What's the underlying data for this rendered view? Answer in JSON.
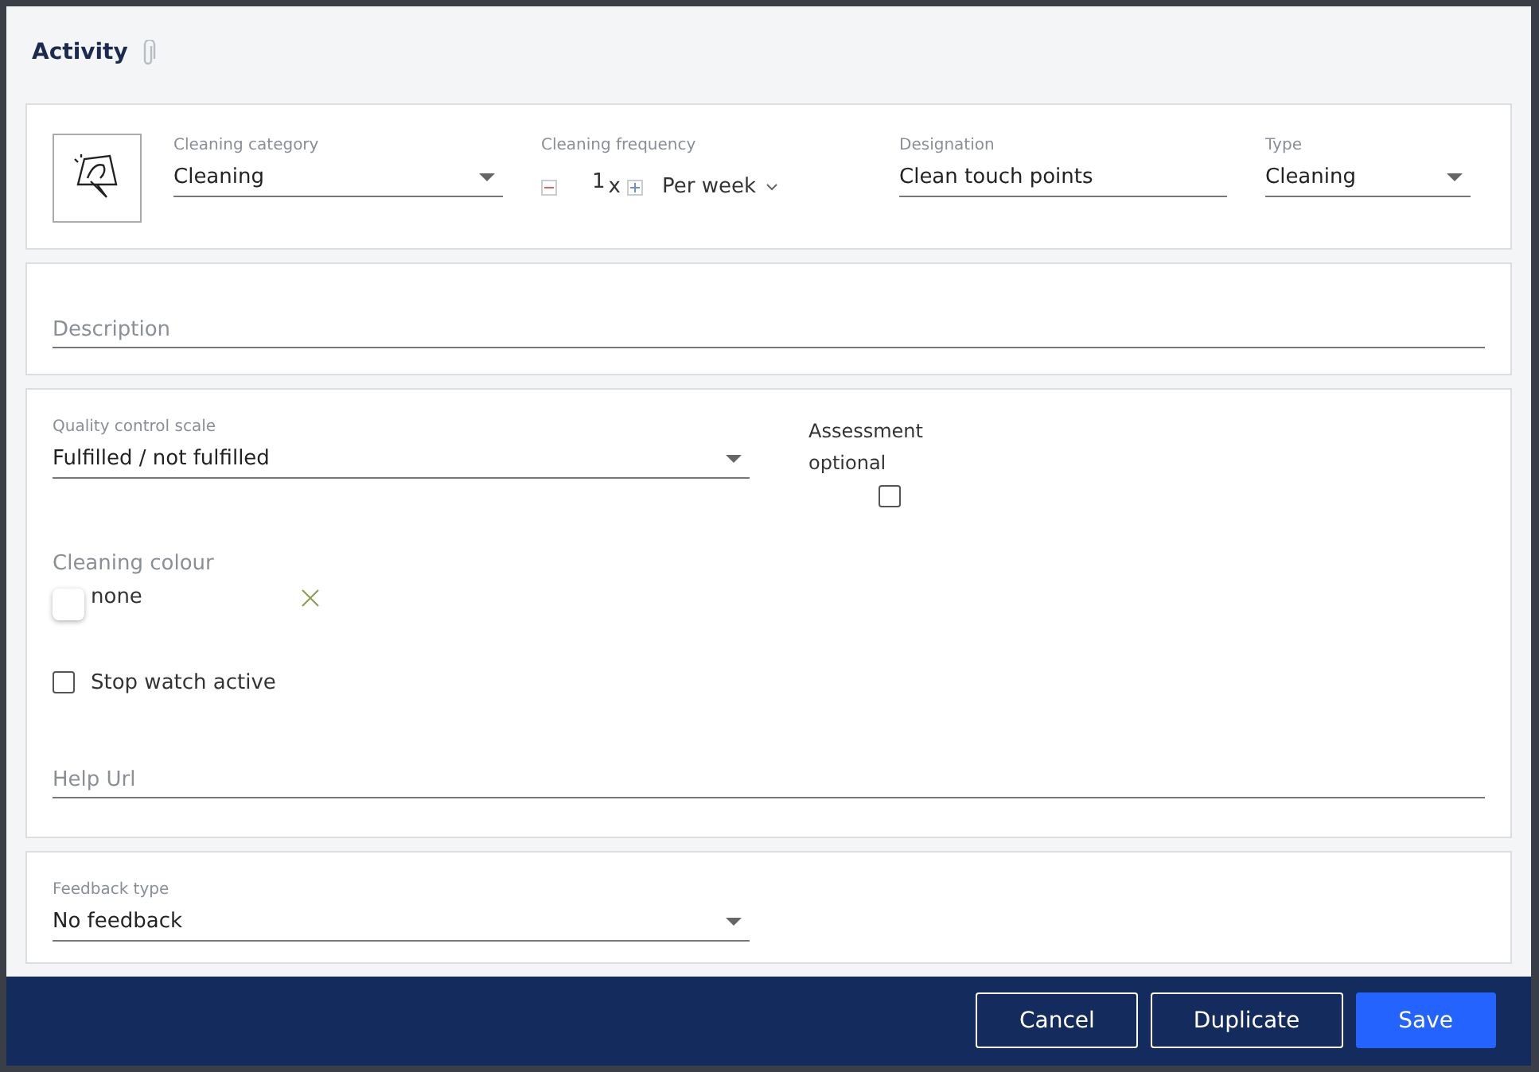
{
  "dialog": {
    "title": "Activity"
  },
  "general": {
    "category": {
      "label": "Cleaning category",
      "value": "Cleaning"
    },
    "frequency": {
      "label": "Cleaning frequency",
      "count": "1",
      "times": "x",
      "period": "Per week"
    },
    "designation": {
      "label": "Designation",
      "value": "Clean touch points"
    },
    "type": {
      "label": "Type",
      "value": "Cleaning"
    }
  },
  "description": {
    "placeholder": "Description"
  },
  "quality": {
    "scale": {
      "label": "Quality control scale",
      "value": "Fulfilled / not fulfilled"
    },
    "assessment_optional": {
      "label": "Assessment optional",
      "checked": false
    },
    "colour": {
      "label": "Cleaning colour",
      "value": "none"
    },
    "stop_watch": {
      "label": "Stop watch active",
      "checked": false
    },
    "help_url": {
      "placeholder": "Help Url"
    }
  },
  "feedback": {
    "label": "Feedback type",
    "value": "No feedback"
  },
  "buttons": [
    {
      "label": "Cancel",
      "kind": "outline"
    },
    {
      "label": "Duplicate",
      "kind": "outline"
    },
    {
      "label": "Save",
      "kind": "primary"
    }
  ]
}
